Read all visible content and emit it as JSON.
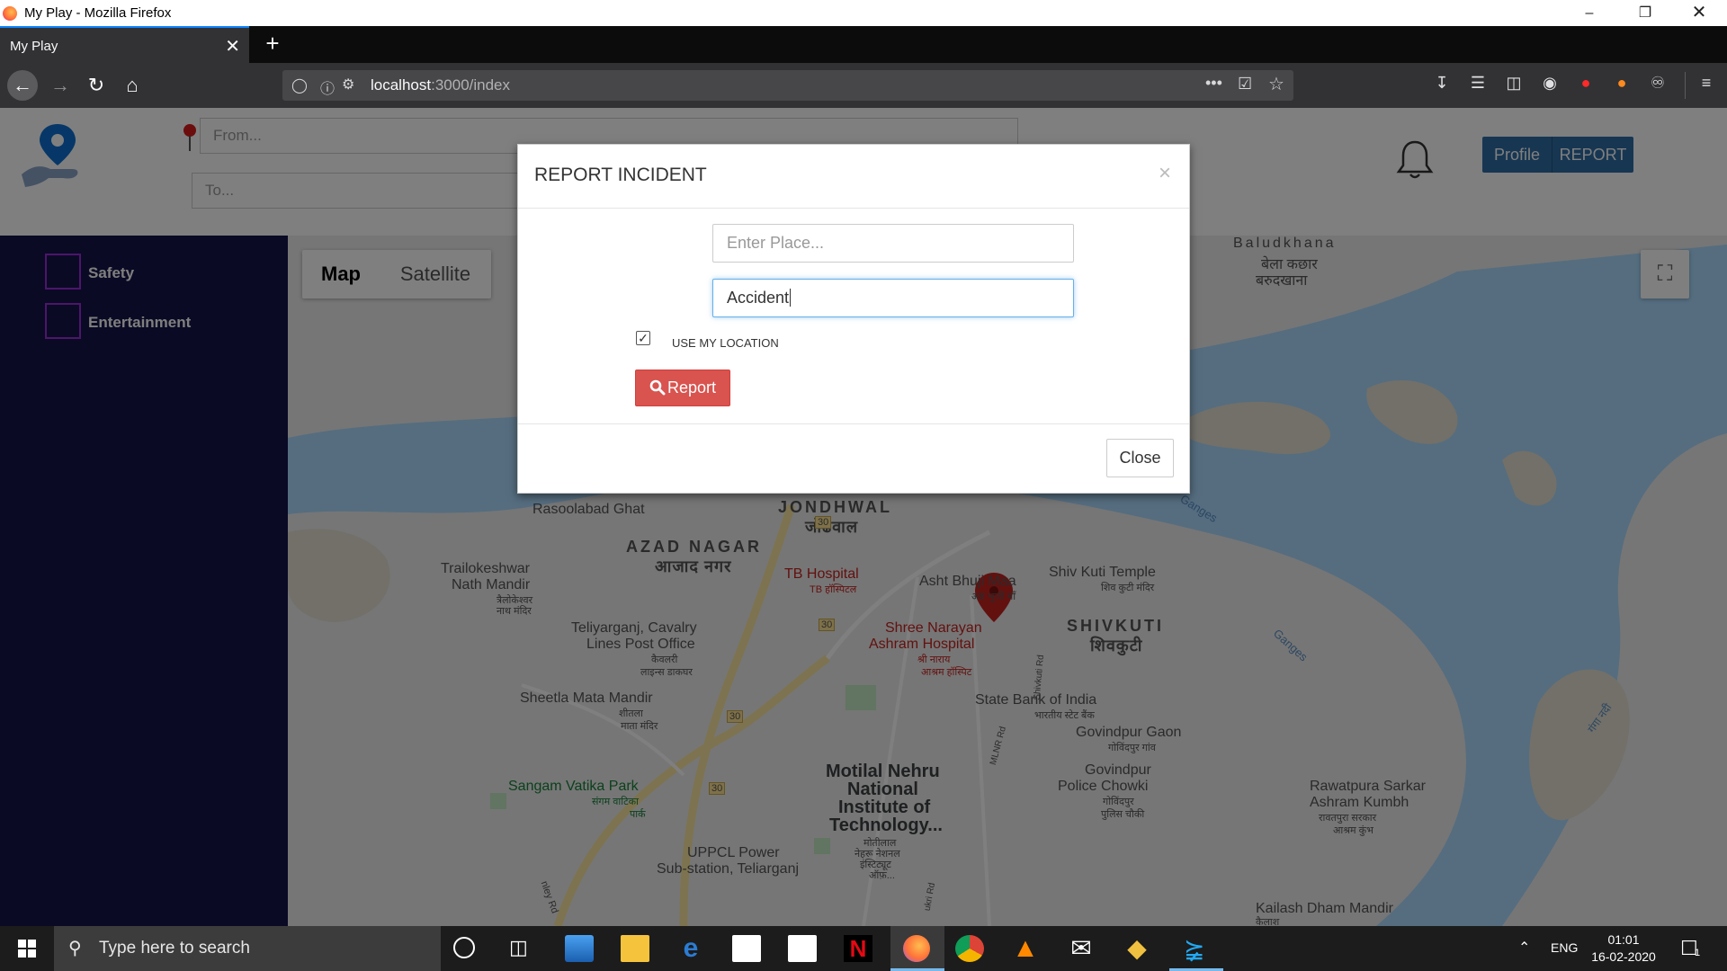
{
  "window": {
    "title": "My Play - Mozilla Firefox"
  },
  "tab": {
    "label": "My Play"
  },
  "urlbar": {
    "host": "localhost",
    "path": ":3000/index"
  },
  "header": {
    "from_placeholder": "From...",
    "to_placeholder": "To...",
    "profile_label": "Profile",
    "report_label": "REPORT"
  },
  "sidebar": {
    "items": [
      {
        "label": "Safety"
      },
      {
        "label": "Entertainment"
      }
    ]
  },
  "map": {
    "type_buttons": [
      "Map",
      "Satellite"
    ],
    "labels": {
      "baludkhana": "Baludkhana",
      "baludkhana_hi1": "बेला  कछार",
      "baludkhana_hi2": "बरुदखाना",
      "rasoolabad": "Rasoolabad Ghat",
      "jondhwal": "JONDHWAL",
      "jondhwal_hi": "जोंढवाल",
      "azad_nagar": "AZAD NAGAR",
      "azad_nagar_hi": "आजाद  नगर",
      "trailokeshwar1": "Trailokeshwar",
      "trailokeshwar2": "Nath Mandir",
      "trailokeshwar_hi1": "त्रैलोकेश्वर",
      "trailokeshwar_hi2": "नाथ मंदिर",
      "tb_hospital": "TB Hospital",
      "tb_hospital_hi": "TB हॉस्पिटल",
      "asht_bhuji": "Asht Bhuji Maa",
      "asht_bhuji_hi": "अष्ट भुजी माँ",
      "shiv_kuti_temple": "Shiv Kuti Temple",
      "shiv_kuti_temple_hi": "शिव कुटी मंदिर",
      "teliyarganj1": "Teliyarganj, Cavalry",
      "teliyarganj2": "Lines Post Office",
      "teliyarganj_hi1": "कैवलरी",
      "teliyarganj_hi2": "लाइन्स डाकघर",
      "shree_narayan1": "Shree Narayan",
      "shree_narayan2": "Ashram Hospital",
      "shree_narayan_hi1": "श्री नाराय",
      "shree_narayan_hi2": "आश्रम हॉस्पिट",
      "shivkuti": "SHIVKUTI",
      "shivkuti_hi": "शिवकुटी",
      "sheetla1": "Sheetla Mata Mandir",
      "sheetla_hi1": "शीतला",
      "sheetla_hi2": "माता मंदिर",
      "sbi": "State Bank of India",
      "sbi_hi": "भारतीय स्टेट बैंक",
      "govindpur_gaon": "Govindpur Gaon",
      "govindpur_gaon_hi": "गोविंदपुर गांव",
      "sangam1": "Sangam Vatika Park",
      "sangam_hi1": "संगम वाटिका",
      "sangam_hi2": "पार्क",
      "mnnit1": "Motilal Nehru",
      "mnnit2": "National",
      "mnnit3": "Institute of",
      "mnnit4": "Technology...",
      "mnnit_hi1": "मोतीलाल",
      "mnnit_hi2": "नेहरू नेशनल",
      "mnnit_hi3": "इंस्टिट्यूट",
      "mnnit_hi4": "ऑफ़...",
      "govindpur_police1": "Govindpur",
      "govindpur_police2": "Police Chowki",
      "govindpur_police_hi1": "गोविंदपुर",
      "govindpur_police_hi2": "पुलिस चौकी",
      "rawatpura1": "Rawatpura Sarkar",
      "rawatpura2": "Ashram Kumbh",
      "rawatpura_hi1": "रावतपुरा सरकार",
      "rawatpura_hi2": "आश्रम कुंभ",
      "uppcl1": "UPPCL Power",
      "uppcl2": "Sub-station, Teliarganj",
      "kailash": "Kailash Dham Mandir",
      "kailash_hi": "कैलाश",
      "ganges1": "Ganges",
      "ganges2": "Ganges",
      "ganga_hi": "गंगा नदी",
      "road30a": "30",
      "road30b": "30",
      "road30c": "30",
      "road30d": "30",
      "stanley_rd": "nley Rd",
      "mlnr_rd": "MLNR Rd",
      "shivkuti_rd": "Shivkuti Rd",
      "lukri_rd": "ukri Rd"
    }
  },
  "modal": {
    "title": "REPORT INCIDENT",
    "close_x": "×",
    "place_placeholder": "Enter Place...",
    "incident_value": "Accident",
    "use_location_label": "USE MY LOCATION",
    "use_location_checked": true,
    "report_label": "Report",
    "close_label": "Close"
  },
  "taskbar": {
    "search_placeholder": "Type here to search",
    "language": "ENG",
    "time": "01:01",
    "date": "16-02-2020",
    "notification_count": "1"
  },
  "colors": {
    "sidebar_bg": "#15154a",
    "category_border": "#9b2bd6",
    "report_button": "#d9534f",
    "header_button": "#2e6da4",
    "water": "#aadaff",
    "road": "#fbe6a1"
  }
}
